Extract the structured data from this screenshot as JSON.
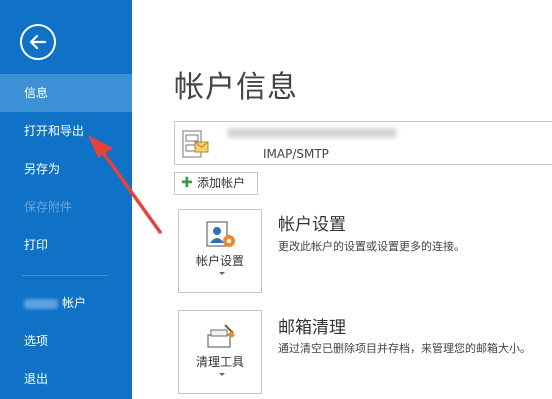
{
  "sidebar": {
    "items": [
      {
        "label": "信息"
      },
      {
        "label": "打开和导出"
      },
      {
        "label": "另存为"
      },
      {
        "label": "保存附件"
      },
      {
        "label": "打印"
      },
      {
        "label": "帐户"
      },
      {
        "label": "选项"
      },
      {
        "label": "退出"
      }
    ]
  },
  "main": {
    "title": "帐户信息",
    "account": {
      "type": "IMAP/SMTP"
    },
    "add_account_label": "添加帐户",
    "sections": [
      {
        "tile_label": "帐户设置",
        "title": "帐户设置",
        "description": "更改此帐户的设置或设置更多的连接。"
      },
      {
        "tile_label": "清理工具",
        "title": "邮箱清理",
        "description": "通过清空已删除项目并存档，来管理您的邮箱大小。"
      }
    ]
  },
  "colors": {
    "sidebar_bg": "#0f72c6",
    "sidebar_active": "#3c90d6",
    "annotation": "#e8403a"
  }
}
